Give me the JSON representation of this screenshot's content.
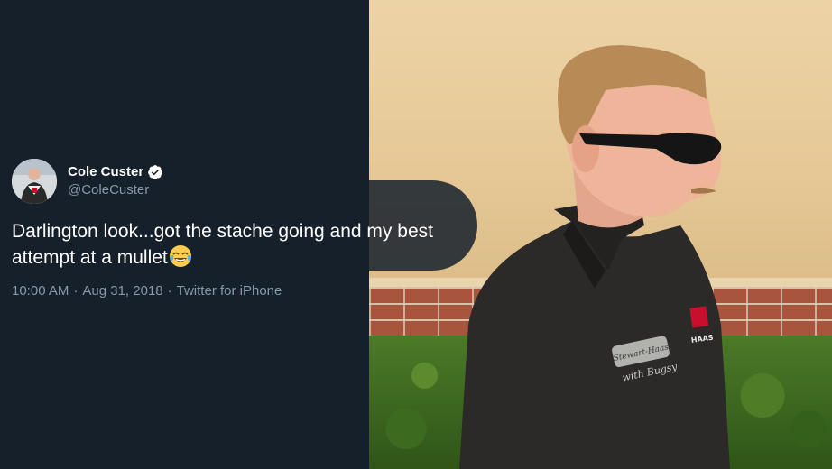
{
  "tweet": {
    "display_name": "Cole Custer",
    "handle": "@ColeCuster",
    "verified_icon": "verified-badge-icon",
    "text": "Darlington look...got the stache going and my best attempt at a mullet",
    "emoji": "face-with-tears-of-joy",
    "time": "10:00 AM",
    "separator": "·",
    "date": "Aug 31, 2018",
    "source": "Twitter for iPhone"
  },
  "photo": {
    "shirt_embroidery": "Stewart-Haas with Bugsy",
    "logo_text": "HAAS"
  },
  "colors": {
    "background": "#15202b",
    "text_primary": "#ffffff",
    "text_secondary": "#8899a6",
    "verified_blue": "#ffffff"
  }
}
